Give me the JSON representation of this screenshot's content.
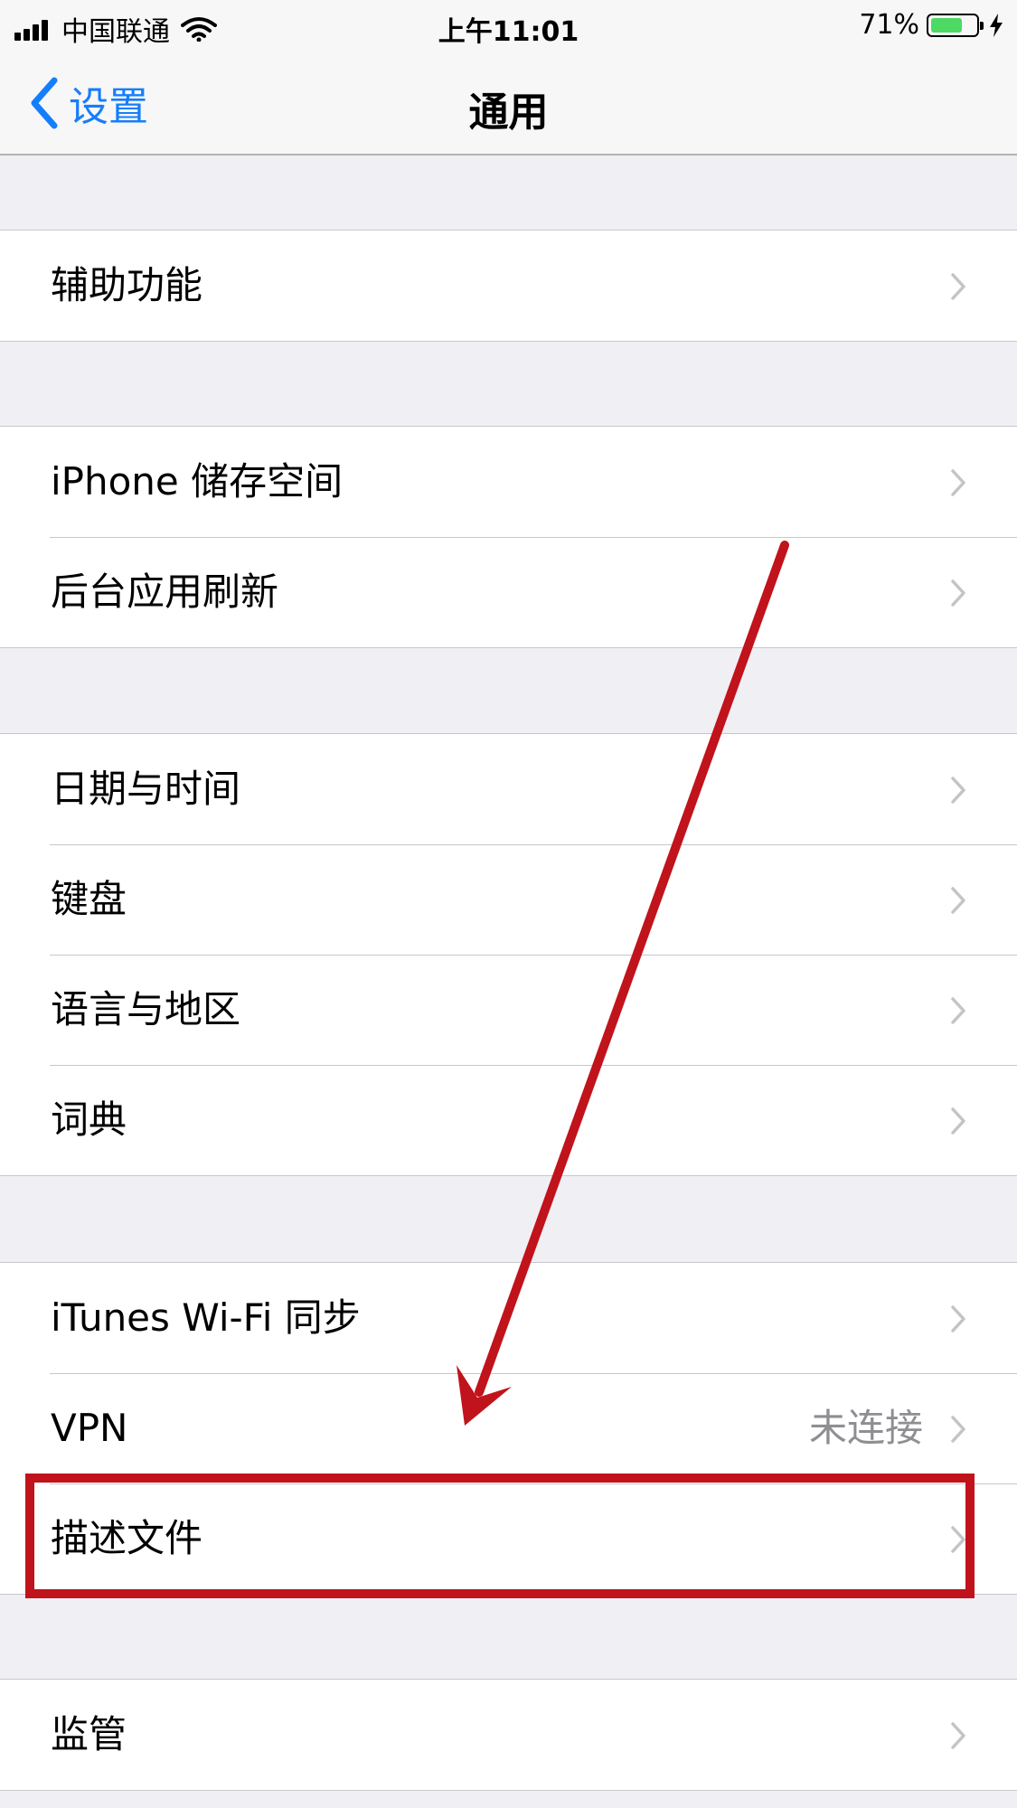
{
  "status_bar": {
    "carrier": "中国联通",
    "time": "上午11:01",
    "battery": "71%",
    "battery_level": 0.71
  },
  "nav": {
    "back_label": "设置",
    "title": "通用"
  },
  "groups": [
    {
      "items": [
        {
          "label": "辅助功能"
        }
      ]
    },
    {
      "items": [
        {
          "label": "iPhone 储存空间"
        },
        {
          "label": "后台应用刷新"
        }
      ]
    },
    {
      "items": [
        {
          "label": "日期与时间"
        },
        {
          "label": "键盘"
        },
        {
          "label": "语言与地区"
        },
        {
          "label": "词典"
        }
      ]
    },
    {
      "items": [
        {
          "label": "iTunes Wi-Fi 同步"
        },
        {
          "label": "VPN",
          "value": "未连接"
        },
        {
          "label": "描述文件"
        }
      ]
    },
    {
      "items": [
        {
          "label": "监管"
        }
      ]
    }
  ],
  "colors": {
    "accent": "#157efb",
    "annotation": "#c0131b",
    "battery": "#4cd964"
  }
}
